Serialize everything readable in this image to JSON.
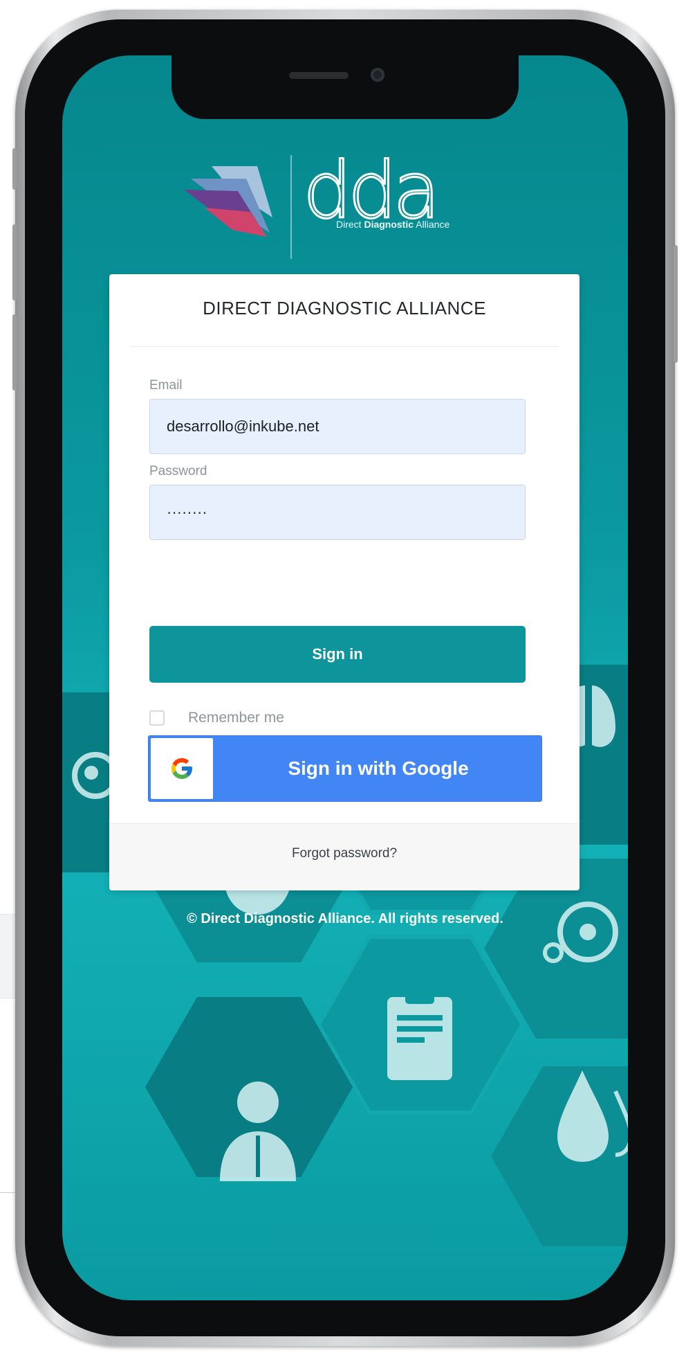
{
  "logo": {
    "wordmark": "dda",
    "tagline_prefix": "Direct",
    "tagline_bold": "Diagnostic",
    "tagline_suffix": "Alliance"
  },
  "card": {
    "title": "DIRECT DIAGNOSTIC ALLIANCE",
    "email": {
      "label": "Email",
      "value": "desarrollo@inkube.net"
    },
    "password": {
      "label": "Password",
      "value": "········"
    },
    "signin_label": "Sign in",
    "remember": {
      "label": "Remember me",
      "checked": false
    },
    "google_label": "Sign in with Google",
    "forgot_label": "Forgot password?"
  },
  "footer": {
    "copyright": "© Direct Diagnostic Alliance. All rights reserved."
  },
  "colors": {
    "teal": "#0e959b",
    "google_blue": "#4285f4",
    "input_bg": "#e8f0fe"
  },
  "icons": [
    "lungs-icon",
    "heart-icon",
    "clipboard-icon",
    "doctor-icon",
    "wheelchair-icon",
    "blood-drops-icon",
    "cells-icon",
    "eye-icon"
  ]
}
